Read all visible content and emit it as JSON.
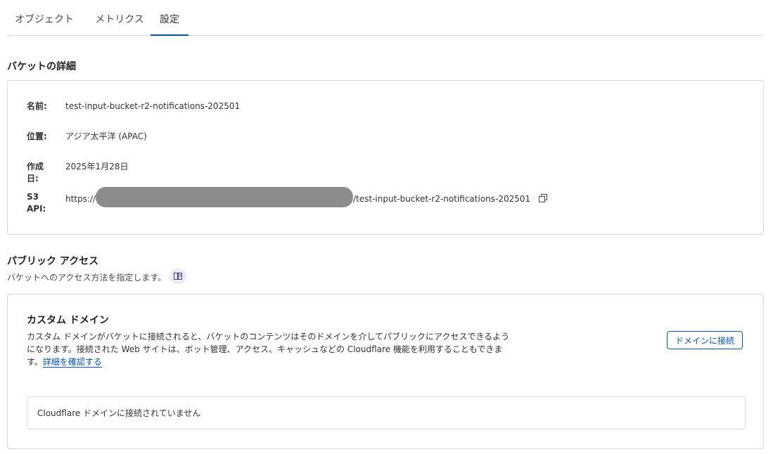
{
  "tabs": [
    {
      "label": "オブジェクト",
      "active": false
    },
    {
      "label": "メトリクス",
      "active": false
    },
    {
      "label": "設定",
      "active": true
    }
  ],
  "bucket_details": {
    "heading": "バケットの詳細",
    "rows": [
      {
        "label": "名前:",
        "value": "test-input-bucket-r2-notifications-202501"
      },
      {
        "label": "位置:",
        "value": "アジア太平洋 (APAC)"
      },
      {
        "label": "作成日:",
        "value": "2025年1月28日"
      },
      {
        "label": "S3 API:",
        "prefix": "https://",
        "suffix": "/test-input-bucket-r2-notifications-202501"
      }
    ]
  },
  "public_access": {
    "heading": "パブリック アクセス",
    "description": "バケットへのアクセス方法を指定します。",
    "help_icon": "book-icon"
  },
  "custom_domain": {
    "title": "カスタム ドメイン",
    "description": "カスタム ドメインがバケットに接続されると、バケットのコンテンツはそのドメインを介してパブリックにアクセスできるようになります。接続された Web サイトは、ボット管理、アクセス、キャッシュなどの Cloudflare 機能を利用することもできます。",
    "link_text": "詳細を確認する",
    "connect_button": "ドメインに接続",
    "status": "Cloudflare ドメインに接続されていません"
  },
  "colors": {
    "accent": "#0051c3",
    "redaction": "#8c8c8c",
    "border": "#d9d9d9"
  }
}
